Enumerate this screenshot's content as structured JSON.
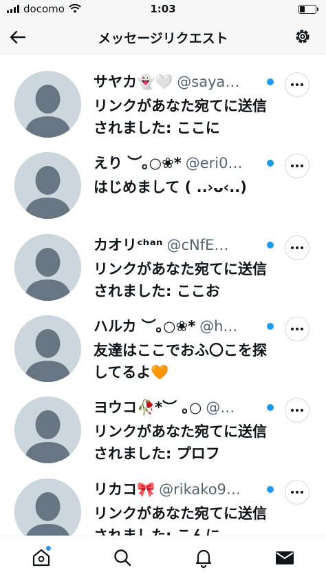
{
  "status_bar": {
    "carrier": "docomo",
    "time": "1:03",
    "battery_level": 0.3
  },
  "header": {
    "title": "メッセージリクエスト",
    "back_icon": "arrow-left-icon",
    "settings_icon": "gear-icon"
  },
  "requests": [
    {
      "name": "サヤカ👻🤍",
      "handle": "@saya…",
      "unread": true,
      "preview": "リンクがあなた宛てに送信されました: ここに"
    },
    {
      "name": "えり ︶｡○❀*",
      "handle": "@eri0…",
      "unread": true,
      "preview": "はじめまして ( ..›ᴗ‹..)"
    },
    {
      "name": "カオリᶜʰᵃⁿ",
      "handle": "@cNfE…",
      "unread": true,
      "preview": "リンクがあなた宛てに送信されました: ここお"
    },
    {
      "name": "ハルカ ︶｡○❀*",
      "handle": "@h…",
      "unread": true,
      "preview": "友達はここでおふ〇こを探してるよ🧡"
    },
    {
      "name": "ヨウコ🥀*︶ ｡○",
      "handle": "@…",
      "unread": true,
      "preview": "リンクがあなた宛てに送信されました: プロフ"
    },
    {
      "name": "リカコ🎀",
      "handle": "@rikako9…",
      "unread": true,
      "preview": "リンクがあなた宛てに送信されました: こんに"
    }
  ],
  "bottom_nav": {
    "items": [
      "home-icon",
      "search-icon",
      "bell-icon",
      "mail-icon"
    ],
    "active": "mail-icon",
    "home_badge": true
  },
  "colors": {
    "accent": "#1d9bf0",
    "avatar_bg": "#ccd6dd",
    "avatar_fg": "#687684",
    "secondary_text": "#536471"
  }
}
